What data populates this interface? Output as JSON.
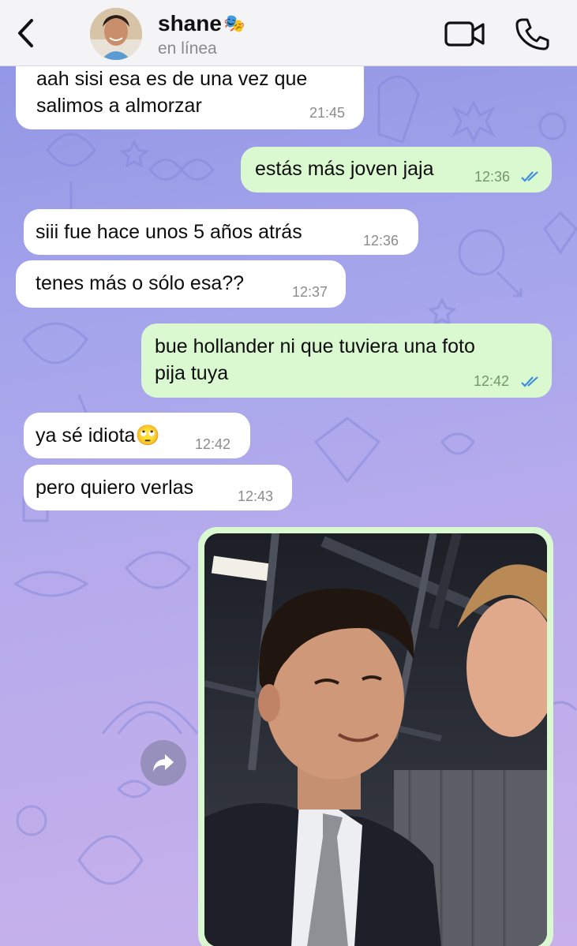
{
  "header": {
    "back_icon": "chevron-left-icon",
    "contact_name": "shane",
    "contact_emoji": "🎭",
    "status": "en línea",
    "video_icon": "video-camera-icon",
    "call_icon": "phone-icon"
  },
  "messages": [
    {
      "direction": "in",
      "text_line1": "aah sisi esa es de una vez que",
      "text_line2": "salimos a almorzar",
      "time": "21:45"
    },
    {
      "direction": "out",
      "text": "estás más joven jaja",
      "time": "12:36",
      "read": true
    },
    {
      "direction": "in",
      "text": "siii fue hace unos 5 años atrás",
      "time": "12:36"
    },
    {
      "direction": "in",
      "text": "tenes más o sólo esa??",
      "time": "12:37"
    },
    {
      "direction": "out",
      "text_line1": "bue hollander ni que tuviera una foto",
      "text_line2": "pija tuya",
      "time": "12:42",
      "read": true
    },
    {
      "direction": "in",
      "text": "ya sé idiota🙄",
      "time": "12:42"
    },
    {
      "direction": "in",
      "text": "pero quiero verlas",
      "time": "12:43"
    }
  ],
  "photo_message": {
    "direction": "out",
    "forward_icon": "forward-arrow-icon"
  },
  "colors": {
    "incoming_bubble": "#ffffff",
    "outgoing_bubble": "#dbf9d0",
    "read_ticks": "#3d8ee0",
    "header_bg": "#f4f4f6"
  }
}
